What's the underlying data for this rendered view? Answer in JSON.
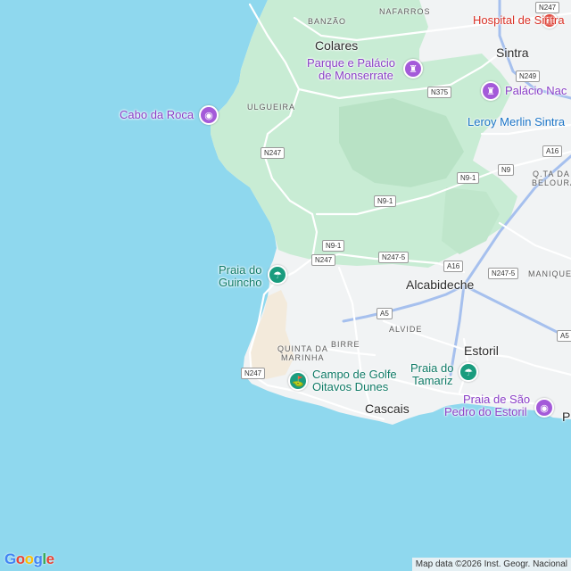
{
  "map": {
    "colors": {
      "sea": "#8fd8ee",
      "land": "#f1f3f4",
      "park": "#c8ecd4",
      "park_dark": "#b8e2c5",
      "beach": "#f3eadb",
      "road_major": "#a6c0ee",
      "road_minor": "#ffffff"
    },
    "towns": {
      "colares": "Colares",
      "sintra": "Sintra",
      "alcabideche": "Alcabideche",
      "estoril": "Estoril",
      "cascais": "Cascais",
      "partial_p": "P"
    },
    "localities": {
      "banzao": "BANZÃO",
      "nafarros": "NAFARROS",
      "ulgueira": "ULGUEIRA",
      "quinta_line1": "QUINTA DA",
      "quinta_line2": "MARINHA",
      "birre": "BIRRE",
      "alvide": "ALVIDE",
      "qta_line1": "Q.TA DA",
      "qta_line2": "BELOURA",
      "manique": "MANIQUE"
    },
    "pois": {
      "hospital": "Hospital de Sintra",
      "monserrate_line1": "Parque e Palácio",
      "monserrate_line2": "de Monserrate",
      "palacio_nacional": "Palácio Nac",
      "cabo_da_roca": "Cabo da Roca",
      "leroy_merlin": "Leroy Merlin Sintra",
      "guincho_line1": "Praia do",
      "guincho_line2": "Guincho",
      "golf_line1": "Campo de Golfe",
      "golf_line2": "Oitavos Dunes",
      "tamariz_line1": "Praia do",
      "tamariz_line2": "Tamariz",
      "sao_pedro_line1": "Praia de São",
      "sao_pedro_line2": "Pedro do Estoril"
    },
    "roads": {
      "n247_top": "N247",
      "n247_west": "N247",
      "n247_mid": "N247",
      "n247_south": "N247",
      "n375": "N375",
      "n249": "N249",
      "a16_east": "A16",
      "a16_mid": "A16",
      "n9": "N9",
      "n9_1_east": "N9-1",
      "n9_1_mid": "N9-1",
      "n9_1_low": "N9-1",
      "n247_5_mid": "N247-5",
      "n247_5_east": "N247-5",
      "a5_mid": "A5",
      "a5_east": "A5"
    },
    "icons": {
      "hospital": "hospital-icon",
      "palace": "castle-icon",
      "viewpoint": "camera-icon",
      "beach": "beach-umbrella-icon",
      "golf": "golf-icon"
    },
    "logo": {
      "g": "G",
      "o1": "o",
      "o2": "o",
      "g2": "g",
      "l": "l",
      "e": "e"
    },
    "attribution": "Map data ©2026 Inst. Geogr. Nacional"
  }
}
